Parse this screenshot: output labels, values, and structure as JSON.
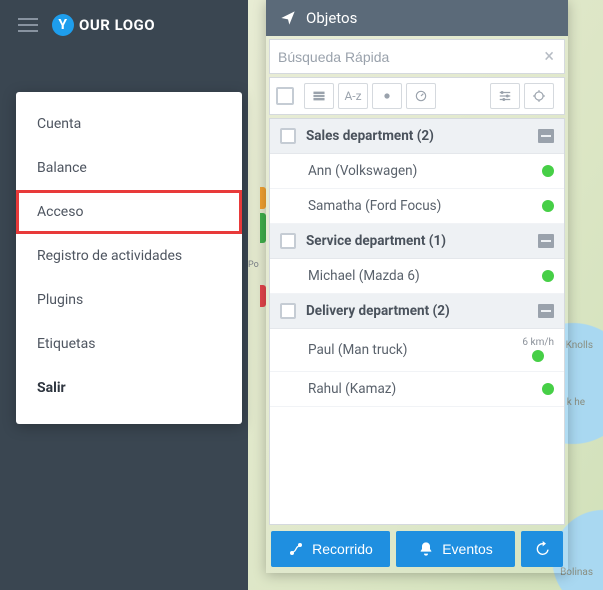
{
  "logo": {
    "letter": "Y",
    "rest": "OUR LOGO"
  },
  "menu": {
    "items": [
      {
        "label": "Cuenta"
      },
      {
        "label": "Balance"
      },
      {
        "label": "Acceso",
        "highlight": true
      },
      {
        "label": "Registro de actividades"
      },
      {
        "label": "Plugins"
      },
      {
        "label": "Etiquetas"
      },
      {
        "label": "Salir",
        "bold": true
      }
    ]
  },
  "panel": {
    "title": "Objetos",
    "search_placeholder": "Búsqueda Rápida",
    "sort_label": "A-z",
    "groups": [
      {
        "title": "Sales department (2)",
        "items": [
          {
            "name": "Ann (Volkswagen)"
          },
          {
            "name": "Samatha (Ford Focus)"
          }
        ]
      },
      {
        "title": "Service department (1)",
        "items": [
          {
            "name": "Michael (Mazda 6)"
          }
        ]
      },
      {
        "title": "Delivery department (2)",
        "items": [
          {
            "name": "Paul (Man truck)",
            "speed": "6 km/h"
          },
          {
            "name": "Rahul (Kamaz)"
          }
        ]
      }
    ],
    "footer": {
      "route": "Recorrido",
      "events": "Eventos"
    }
  },
  "map_labels": {
    "a": "Forest\nKnolls",
    "b": "k\nhe",
    "c": "Bolinas",
    "po": "Po"
  }
}
